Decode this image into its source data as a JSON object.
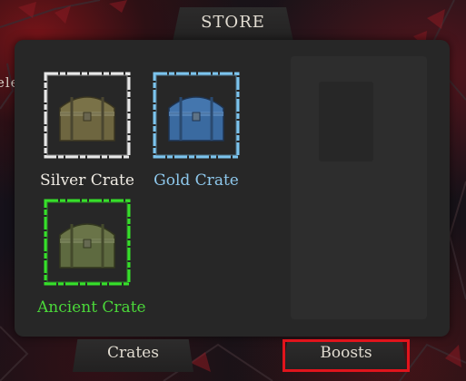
{
  "store": {
    "title": "STORE"
  },
  "background": {
    "partial_text": "ele"
  },
  "crates": [
    {
      "label": "Silver Crate",
      "label_color": "#f0ece4",
      "frame_color": "#e8e8e8",
      "chest_tint": "#6e6640"
    },
    {
      "label": "Gold Crate",
      "label_color": "#8ec8ec",
      "frame_color": "#7cc4ee",
      "chest_tint": "#3a6aa0"
    },
    {
      "label": "Ancient Crate",
      "label_color": "#4bd83a",
      "frame_color": "#36e02a",
      "chest_tint": "#5e6a40"
    }
  ],
  "tabs": [
    {
      "label": "Crates",
      "selected": false
    },
    {
      "label": "Boosts",
      "selected": true
    }
  ],
  "colors": {
    "panel": "#272727",
    "selected_outline": "#e1141c"
  }
}
